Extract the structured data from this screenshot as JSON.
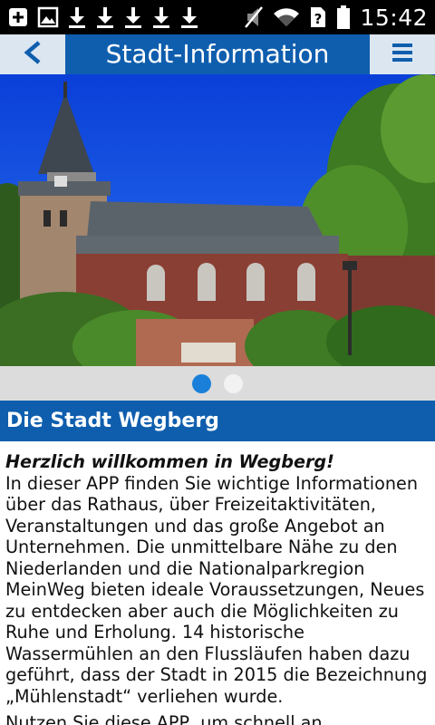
{
  "status_bar": {
    "time": "15:42",
    "left_icons": [
      "add-box-icon",
      "image-icon",
      "download-icon",
      "download-icon",
      "download-icon",
      "download-icon",
      "download-icon"
    ],
    "right_icons": [
      "mute-icon",
      "wifi-icon",
      "sim-unknown-icon",
      "battery-icon"
    ]
  },
  "app_bar": {
    "title": "Stadt-Information",
    "back_icon": "chevron-left-icon",
    "menu_icon": "menu-icon",
    "bar_color": "#0f5eae",
    "button_bg": "#dbe6f1"
  },
  "carousel": {
    "page_count": 2,
    "active_index": 0,
    "active_color": "#1a7fd9"
  },
  "section": {
    "heading": "Die Stadt Wegberg"
  },
  "content": {
    "welcome": "Herzlich willkommen in Wegberg!",
    "paragraph": "In dieser APP finden Sie wichtige Informationen über das Rathaus, über Freizeitaktivitäten, Veranstaltungen und das große Angebot an Unternehmen. Die unmittelbare Nähe zu den Niederlanden und die Nationalparkregion MeinWeg bieten ideale Voraussetzungen, Neues zu entdecken aber auch die Möglichkeiten zu Ruhe und Erholung. 14 historische Wassermühlen an den Flussläufen haben dazu geführt, dass der Stadt in 2015 die Bezeichnung „Mühlenstadt“ verliehen wurde.",
    "next_line": "Nutzen Sie diese APP, um schnell an Informationen"
  }
}
